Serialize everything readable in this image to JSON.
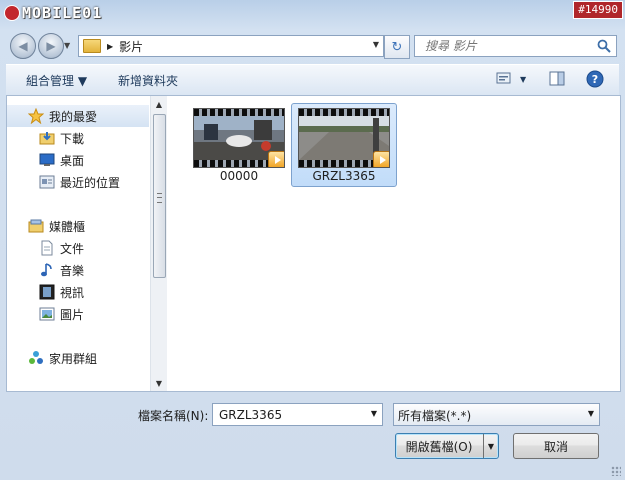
{
  "watermark": {
    "logo_text": "MOBILE01",
    "badge": "#14990"
  },
  "nav": {
    "back_icon": "back-arrow-icon",
    "forward_icon": "forward-arrow-icon",
    "path": "影片",
    "search_placeholder": "搜尋 影片"
  },
  "toolbar": {
    "organize_label": "組合管理 ▼",
    "new_folder_label": "新增資料夾"
  },
  "sidebar": {
    "favorites": "我的最愛",
    "downloads": "下載",
    "desktop": "桌面",
    "recent": "最近的位置",
    "libraries": "媒體櫃",
    "documents": "文件",
    "music": "音樂",
    "videos": "視訊",
    "pictures": "圖片",
    "homegroup": "家用群組"
  },
  "files": [
    {
      "name": "00000",
      "selected": false
    },
    {
      "name": "GRZL3365",
      "selected": true
    }
  ],
  "bottom": {
    "filename_label": "檔案名稱(N):",
    "filename_value": "GRZL3365",
    "filetype_value": "所有檔案(*.*)",
    "open_label": "開啟舊檔(O)",
    "cancel_label": "取消"
  },
  "colors": {
    "selection": "#c1dcf9",
    "accent": "#3c7fb1",
    "play_badge": "#f1a21f"
  }
}
